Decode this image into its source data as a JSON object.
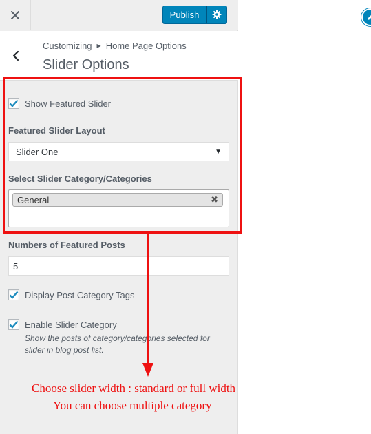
{
  "topbar": {
    "close_icon": "close-icon",
    "publish_label": "Publish",
    "settings_icon": "gear-icon"
  },
  "header": {
    "back_icon": "chevron-left-icon",
    "breadcrumb_root": "Customizing",
    "breadcrumb_separator_icon": "triangle-right-icon",
    "breadcrumb_parent": "Home Page Options",
    "title": "Slider Options"
  },
  "controls": {
    "show_featured_slider": {
      "label": "Show Featured Slider",
      "checked": true
    },
    "slider_layout": {
      "title": "Featured Slider Layout",
      "selected": "Slider One"
    },
    "slider_category": {
      "title": "Select Slider Category/Categories",
      "tags": [
        "General"
      ]
    },
    "featured_posts_count": {
      "title": "Numbers of Featured Posts",
      "value": "5"
    },
    "display_post_category_tags": {
      "label": "Display Post Category Tags",
      "checked": true
    },
    "enable_slider_category": {
      "label": "Enable Slider Category",
      "checked": true,
      "description": "Show the posts of category/categories selected for slider in blog post list."
    }
  },
  "annotation": {
    "line1": "Choose slider width : standard or full width",
    "line2": "You can choose multiple category",
    "color": "#ee1111"
  },
  "colors": {
    "accent": "#0085ba",
    "panel_bg": "#eeeeee"
  }
}
